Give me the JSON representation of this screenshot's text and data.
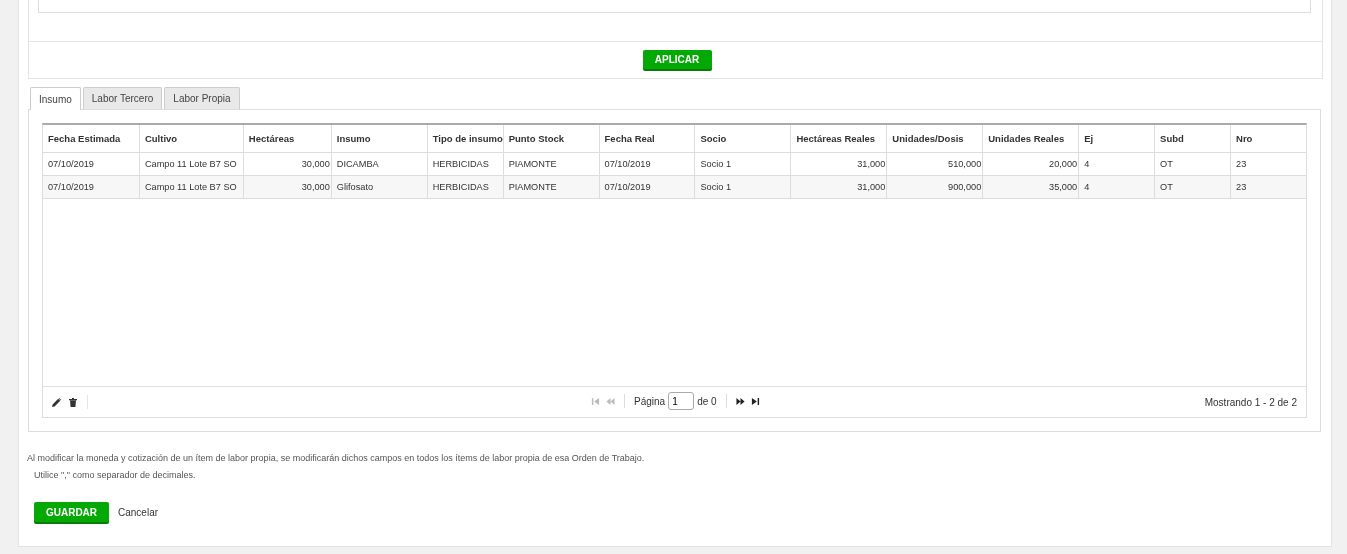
{
  "apply_button": {
    "label": "APLICAR"
  },
  "tabs": [
    {
      "label": "Insumo",
      "selected": true
    },
    {
      "label": "Labor Tercero",
      "selected": false
    },
    {
      "label": "Labor Propia",
      "selected": false
    }
  ],
  "table": {
    "columns": [
      {
        "label": "Fecha Estimada",
        "kind": "text"
      },
      {
        "label": "Cultivo",
        "kind": "text"
      },
      {
        "label": "Hectáreas",
        "kind": "number"
      },
      {
        "label": "Insumo",
        "kind": "text"
      },
      {
        "label": "Tipo de insumo",
        "kind": "text"
      },
      {
        "label": "Punto Stock",
        "kind": "text"
      },
      {
        "label": "Fecha Real",
        "kind": "text"
      },
      {
        "label": "Socio",
        "kind": "text"
      },
      {
        "label": "Hectáreas Reales",
        "kind": "number"
      },
      {
        "label": "Unidades/Dosis",
        "kind": "number"
      },
      {
        "label": "Unidades Reales",
        "kind": "number"
      },
      {
        "label": "Ej",
        "kind": "text"
      },
      {
        "label": "Subd",
        "kind": "text"
      },
      {
        "label": "Nro",
        "kind": "text"
      }
    ],
    "rows": [
      [
        "07/10/2019",
        "Campo 11 Lote B7 SO",
        "30,000",
        "DICAMBA",
        "HERBICIDAS",
        "PIAMONTE",
        "07/10/2019",
        "Socio 1",
        "31,000",
        "510,000",
        "20,000",
        "4",
        "OT",
        "23"
      ],
      [
        "07/10/2019",
        "Campo 11 Lote B7 SO",
        "30,000",
        "Glifosato",
        "HERBICIDAS",
        "PIAMONTE",
        "07/10/2019",
        "Socio 1",
        "31,000",
        "900,000",
        "35,000",
        "4",
        "OT",
        "23"
      ]
    ]
  },
  "pager": {
    "actions": [
      {
        "kind": "edit"
      },
      {
        "kind": "delete"
      }
    ],
    "nav_back": [
      {
        "kind": "first",
        "disabled": true
      },
      {
        "kind": "prev",
        "disabled": true
      }
    ],
    "page_label": "Página",
    "page_value": "1",
    "of_label": "de 0",
    "nav_forward": [
      {
        "kind": "next",
        "disabled": false
      },
      {
        "kind": "last",
        "disabled": false
      }
    ],
    "summary": "Mostrando 1 - 2 de 2"
  },
  "notes": [
    "Al modificar la moneda y cotización de un ítem de labor propia, se modificarán dichos campos en todos los ítems de labor propia de esa Orden de Trabajo.",
    "Utilice \",\" como separador de decimales."
  ],
  "save_button": {
    "label": "GUARDAR"
  },
  "cancel_link": {
    "label": "Cancelar"
  }
}
